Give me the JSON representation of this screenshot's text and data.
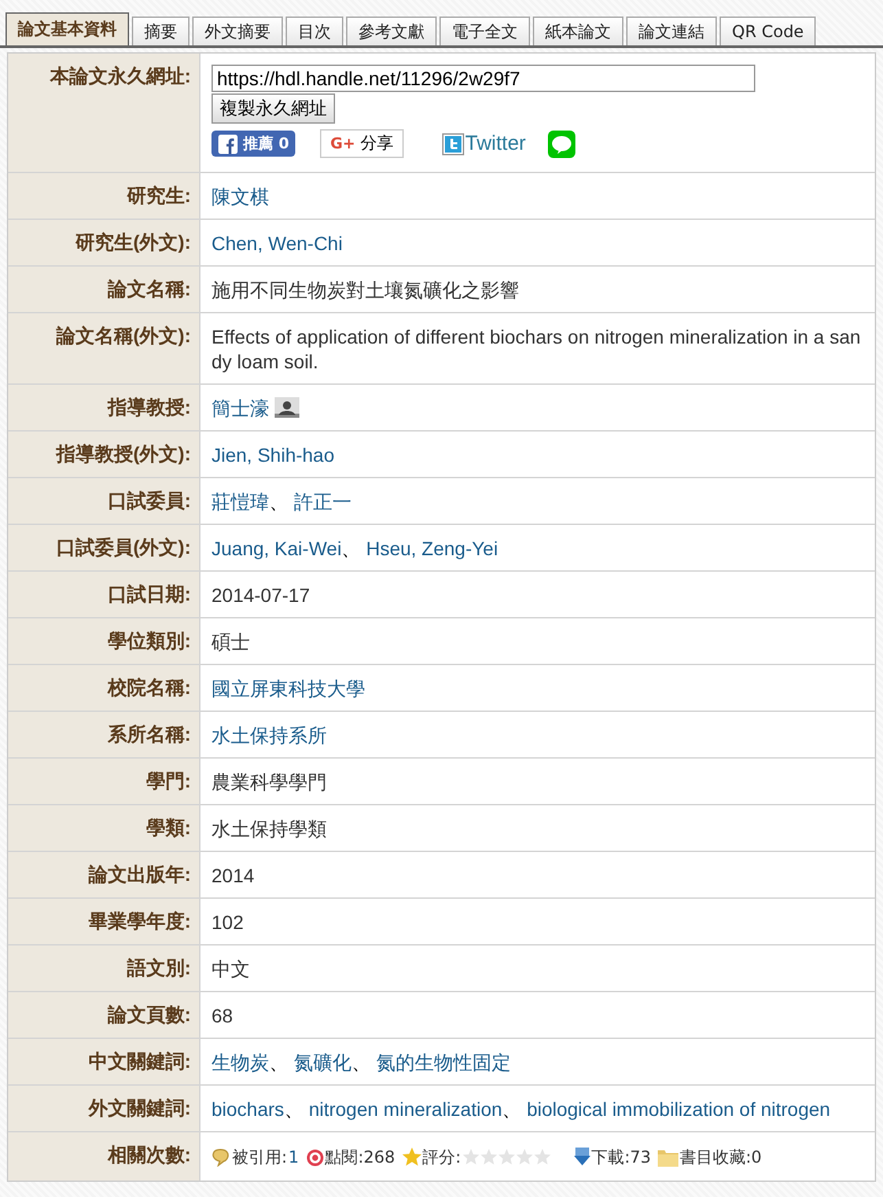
{
  "tabs": [
    {
      "label": "論文基本資料",
      "selected": true
    },
    {
      "label": "摘要",
      "selected": false
    },
    {
      "label": "外文摘要",
      "selected": false
    },
    {
      "label": "目次",
      "selected": false
    },
    {
      "label": "參考文獻",
      "selected": false
    },
    {
      "label": "電子全文",
      "selected": false
    },
    {
      "label": "紙本論文",
      "selected": false
    },
    {
      "label": "論文連結",
      "selected": false
    },
    {
      "label": "QR Code",
      "selected": false
    }
  ],
  "permalink": {
    "label": "本論文永久網址:",
    "url": "https://hdl.handle.net/11296/2w29f7",
    "copy_button": "複製永久網址",
    "facebook": "推薦 0",
    "google_mark": "G+",
    "google": "分享",
    "twitter": "Twitter"
  },
  "rows": [
    {
      "label": "研究生:",
      "values": [
        {
          "text": "陳文棋",
          "link": true
        }
      ]
    },
    {
      "label": "研究生(外文):",
      "values": [
        {
          "text": "Chen, Wen-Chi",
          "link": true
        }
      ]
    },
    {
      "label": "論文名稱:",
      "values": [
        {
          "text": "施用不同生物炭對土壤氮礦化之影響",
          "link": false
        }
      ]
    },
    {
      "label": "論文名稱(外文):",
      "values": [
        {
          "text": "Effects of application of different biochars on nitrogen mineralization in a sandy loam soil.",
          "link": false
        }
      ]
    },
    {
      "label": "指導教授:",
      "values": [
        {
          "text": "簡士濠",
          "link": true
        }
      ],
      "photo": true
    },
    {
      "label": "指導教授(外文):",
      "values": [
        {
          "text": "Jien, Shih-hao",
          "link": true
        }
      ]
    },
    {
      "label": "口試委員:",
      "separator": "、",
      "values": [
        {
          "text": "莊愷瑋",
          "link": true
        },
        {
          "text": "許正一",
          "link": true
        }
      ]
    },
    {
      "label": "口試委員(外文):",
      "separator": "、",
      "values": [
        {
          "text": "Juang, Kai-Wei",
          "link": true
        },
        {
          "text": "Hseu, Zeng-Yei",
          "link": true
        }
      ]
    },
    {
      "label": "口試日期:",
      "values": [
        {
          "text": "2014-07-17",
          "link": false
        }
      ]
    },
    {
      "label": "學位類別:",
      "values": [
        {
          "text": "碩士",
          "link": false
        }
      ]
    },
    {
      "label": "校院名稱:",
      "values": [
        {
          "text": "國立屏東科技大學",
          "link": true
        }
      ]
    },
    {
      "label": "系所名稱:",
      "values": [
        {
          "text": "水土保持系所",
          "link": true
        }
      ]
    },
    {
      "label": "學門:",
      "values": [
        {
          "text": "農業科學學門",
          "link": false
        }
      ]
    },
    {
      "label": "學類:",
      "values": [
        {
          "text": "水土保持學類",
          "link": false
        }
      ]
    },
    {
      "label": "論文出版年:",
      "values": [
        {
          "text": "2014",
          "link": false
        }
      ]
    },
    {
      "label": "畢業學年度:",
      "values": [
        {
          "text": "102",
          "link": false
        }
      ]
    },
    {
      "label": "語文別:",
      "values": [
        {
          "text": "中文",
          "link": false
        }
      ]
    },
    {
      "label": "論文頁數:",
      "values": [
        {
          "text": "68",
          "link": false
        }
      ]
    },
    {
      "label": "中文關鍵詞:",
      "separator": "、",
      "values": [
        {
          "text": "生物炭",
          "link": true
        },
        {
          "text": "氮礦化",
          "link": true
        },
        {
          "text": "氮的生物性固定",
          "link": true
        }
      ]
    },
    {
      "label": "外文關鍵詞:",
      "separator": "、",
      "values": [
        {
          "text": "biochars",
          "link": true
        },
        {
          "text": "nitrogen mineralization",
          "link": true
        },
        {
          "text": "biological immobilization of nitrogen",
          "link": true
        }
      ]
    }
  ],
  "stats": {
    "label": "相關次數:",
    "cited_label": "被引用:",
    "cited": "1",
    "views_label": "點閱:268",
    "rating_label": "評分:",
    "stars": 0,
    "downloads_label": "下載:73",
    "bookmarks_label": "書目收藏:0"
  }
}
